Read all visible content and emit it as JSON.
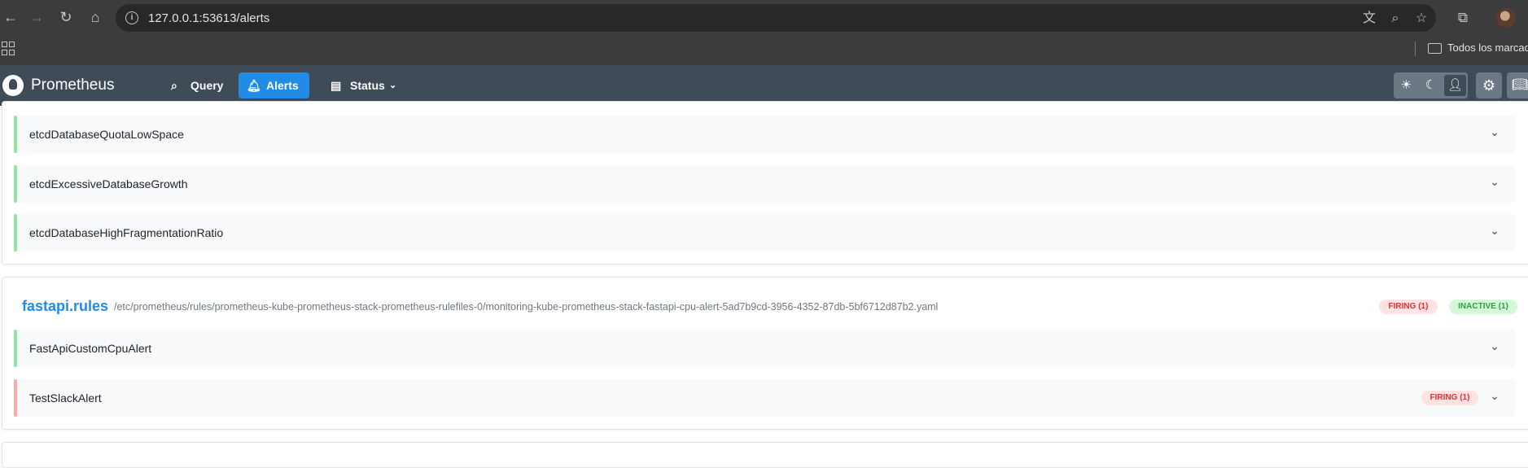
{
  "browser": {
    "url": "127.0.0.1:53613/alerts",
    "bookmarks_folder": "Todos los marcado"
  },
  "header": {
    "brand": "Prometheus",
    "nav": [
      {
        "label": "Query",
        "icon": "search-icon"
      },
      {
        "label": "Alerts",
        "icon": "bell-icon",
        "active": true
      },
      {
        "label": "Status",
        "icon": "server-icon",
        "dropdown": true
      }
    ],
    "theme_options": [
      "light",
      "dark",
      "auto"
    ],
    "theme_selected": "auto"
  },
  "groups": [
    {
      "name": "",
      "rules": [
        {
          "name": "etcdDatabaseQuotaLowSpace",
          "state": "inactive"
        },
        {
          "name": "etcdExcessiveDatabaseGrowth",
          "state": "inactive"
        },
        {
          "name": "etcdDatabaseHighFragmentationRatio",
          "state": "inactive"
        }
      ]
    },
    {
      "name": "fastapi.rules",
      "file": "/etc/prometheus/rules/prometheus-kube-prometheus-stack-prometheus-rulefiles-0/monitoring-kube-prometheus-stack-fastapi-cpu-alert-5ad7b9cd-3956-4352-87db-5bf6712d87b2.yaml",
      "badges": {
        "firing": "FIRING (1)",
        "inactive": "INACTIVE (1)"
      },
      "rules": [
        {
          "name": "FastApiCustomCpuAlert",
          "state": "inactive"
        },
        {
          "name": "TestSlackAlert",
          "state": "firing",
          "badge": "FIRING (1)"
        }
      ]
    }
  ],
  "colors": {
    "header_bg": "#3f4b57",
    "accent": "#228be6",
    "inactive_bar": "#8ce99a",
    "firing_bar": "#ffa8a8"
  }
}
